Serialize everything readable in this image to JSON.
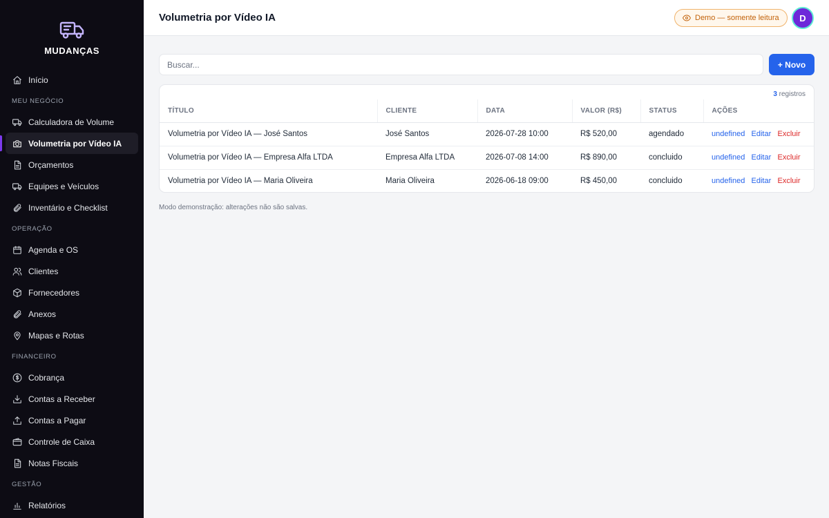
{
  "brand": {
    "name": "MUDANÇAS",
    "icon": "moving-truck-icon",
    "accent": "#7c3aed"
  },
  "sidebar": {
    "top": [
      {
        "label": "Início",
        "icon": "home-icon"
      }
    ],
    "sections": [
      {
        "label": "MEU NEGÓCIO",
        "items": [
          {
            "label": "Calculadora de Volume",
            "icon": "truck-icon"
          },
          {
            "label": "Volumetria por Vídeo IA",
            "icon": "camera-icon",
            "active": true
          },
          {
            "label": "Orçamentos",
            "icon": "document-icon"
          },
          {
            "label": "Equipes e Veículos",
            "icon": "truck-icon"
          },
          {
            "label": "Inventário e Checklist",
            "icon": "paperclip-icon"
          }
        ]
      },
      {
        "label": "OPERAÇÃO",
        "items": [
          {
            "label": "Agenda e OS",
            "icon": "calendar-icon"
          },
          {
            "label": "Clientes",
            "icon": "users-icon"
          },
          {
            "label": "Fornecedores",
            "icon": "box-icon"
          },
          {
            "label": "Anexos",
            "icon": "paperclip-icon"
          },
          {
            "label": "Mapas e Rotas",
            "icon": "map-pin-icon"
          }
        ]
      },
      {
        "label": "FINANCEIRO",
        "items": [
          {
            "label": "Cobrança",
            "icon": "dollar-icon"
          },
          {
            "label": "Contas a Receber",
            "icon": "download-icon"
          },
          {
            "label": "Contas a Pagar",
            "icon": "upload-icon"
          },
          {
            "label": "Controle de Caixa",
            "icon": "wallet-icon"
          },
          {
            "label": "Notas Fiscais",
            "icon": "document-icon"
          }
        ]
      },
      {
        "label": "GESTÃO",
        "items": [
          {
            "label": "Relatórios",
            "icon": "bar-chart-icon"
          }
        ]
      }
    ]
  },
  "header": {
    "title": "Volumetria por Vídeo IA",
    "demo_badge": "Demo — somente leitura",
    "avatar_initial": "D"
  },
  "toolbar": {
    "search_placeholder": "Buscar...",
    "new_label": "+ Novo"
  },
  "table": {
    "count": "3",
    "count_suffix": " registros",
    "columns": [
      "TÍTULO",
      "CLIENTE",
      "DATA",
      "VALOR (R$)",
      "STATUS",
      "AÇÕES"
    ],
    "rows": [
      {
        "titulo": "Volumetria por Vídeo IA — José Santos",
        "cliente": "José Santos",
        "data": "2026-07-28 10:00",
        "valor": "R$ 520,00",
        "status": "agendado"
      },
      {
        "titulo": "Volumetria por Vídeo IA — Empresa Alfa LTDA",
        "cliente": "Empresa Alfa LTDA",
        "data": "2026-07-08 14:00",
        "valor": "R$ 890,00",
        "status": "concluido"
      },
      {
        "titulo": "Volumetria por Vídeo IA — Maria Oliveira",
        "cliente": "Maria Oliveira",
        "data": "2026-06-18 09:00",
        "valor": "R$ 450,00",
        "status": "concluido"
      }
    ],
    "actions": {
      "undefined": "undefined",
      "edit": "Editar",
      "delete": "Excluir"
    }
  },
  "footnote": "Modo demonstração: alterações não são salvas."
}
